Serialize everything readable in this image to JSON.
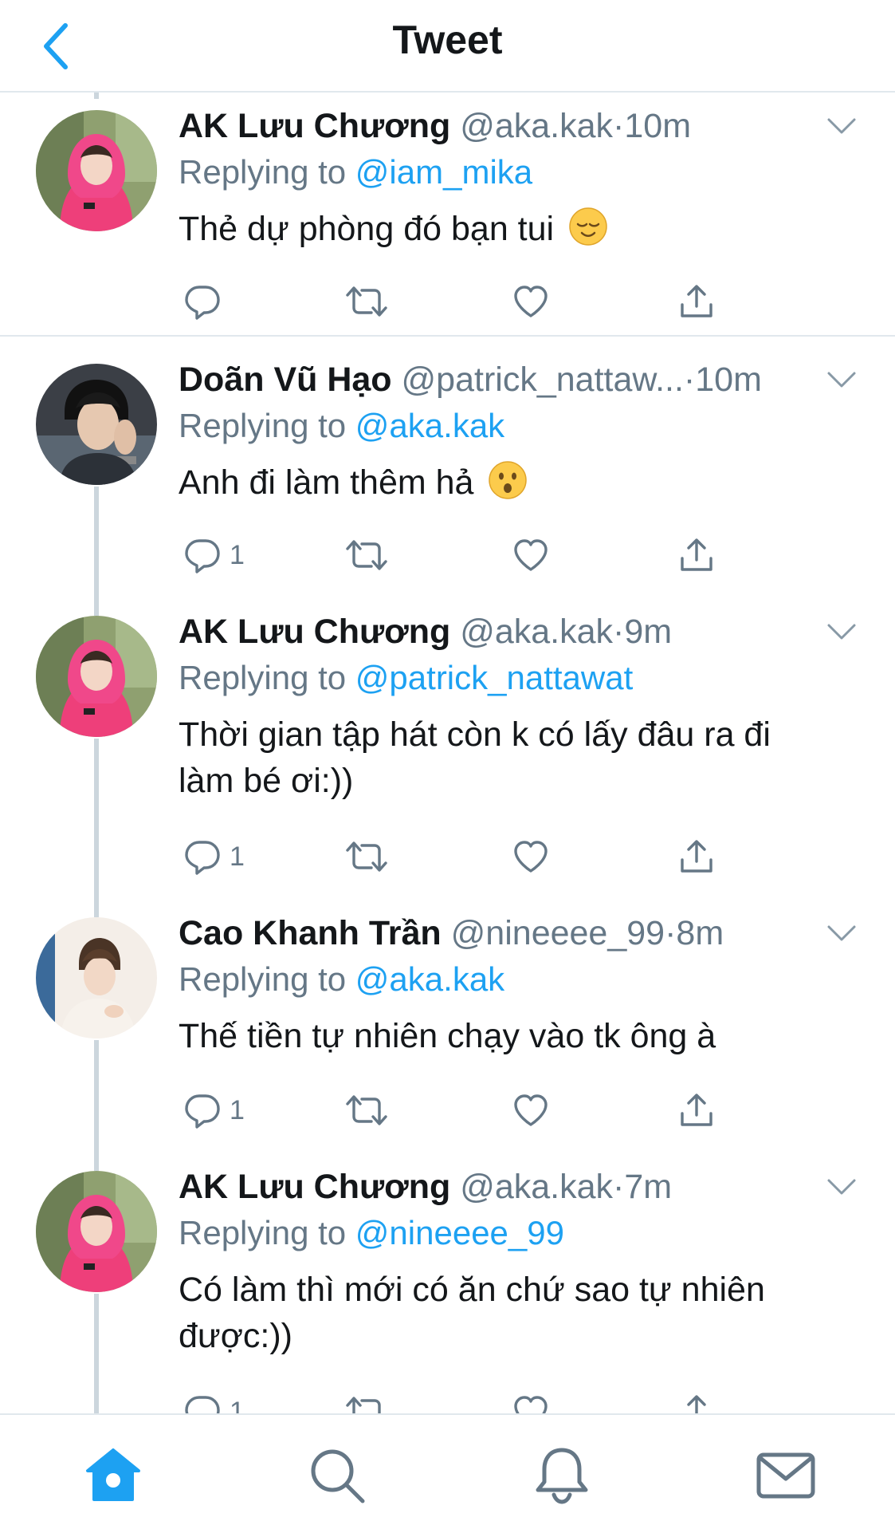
{
  "header": {
    "title": "Tweet",
    "back_icon": "chevron-left-icon"
  },
  "colors": {
    "accent": "#1da1f2",
    "text": "#14171a",
    "muted": "#657786",
    "divider": "#e1e8ed"
  },
  "tweets": [
    {
      "name": "AK Lưu Chương",
      "handle": "@aka.kak",
      "sep": "·",
      "time": "10m",
      "replying_label": "Replying to ",
      "replying_to": "@iam_mika",
      "text": "Thẻ dự phòng đó bạn tui",
      "emoji": "relieved-face",
      "reply_count": ""
    },
    {
      "name": "Doãn Vũ Hạo",
      "handle": "@patrick_nattaw...",
      "sep": "·",
      "time": "10m",
      "replying_label": "Replying to ",
      "replying_to": "@aka.kak",
      "text": "Anh đi làm thêm hả",
      "emoji": "hushed-face",
      "reply_count": "1"
    },
    {
      "name": "AK Lưu Chương",
      "handle": "@aka.kak",
      "sep": "·",
      "time": "9m",
      "replying_label": "Replying to ",
      "replying_to": "@patrick_nattawat",
      "text_line1": "Thời gian tập hát còn k có lấy đâu ra đi",
      "text_line2": "làm bé ơi:))",
      "reply_count": "1"
    },
    {
      "name": "Cao Khanh Trần",
      "handle": "@nineeee_99",
      "sep": "·",
      "time": "8m",
      "replying_label": "Replying to ",
      "replying_to": "@aka.kak",
      "text": "Thế tiền tự nhiên chạy vào tk ông à",
      "reply_count": "1"
    },
    {
      "name": "AK Lưu Chương",
      "handle": "@aka.kak",
      "sep": "·",
      "time": "7m",
      "replying_label": "Replying to ",
      "replying_to": "@nineeee_99",
      "text_line1": "Có làm thì mới có ăn chứ sao tự nhiên",
      "text_line2": "được:))",
      "reply_count": "1"
    }
  ],
  "tabbar": {
    "items": [
      "home-icon",
      "search-icon",
      "notifications-bell-icon",
      "messages-envelope-icon"
    ]
  }
}
